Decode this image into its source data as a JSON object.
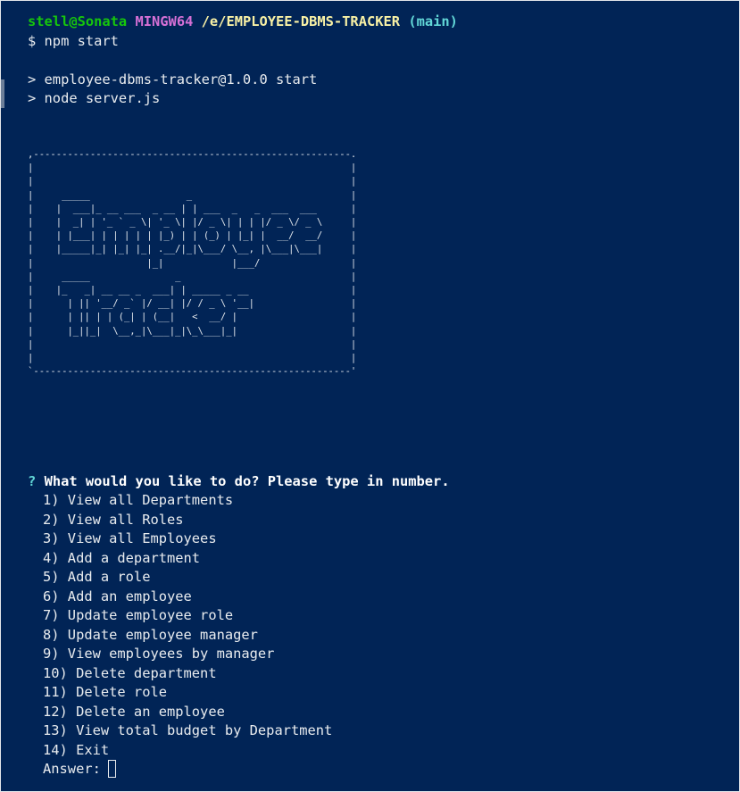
{
  "prompt": {
    "user_host": "stell@Sonata",
    "shell": "MINGW64",
    "path": "/e/EMPLOYEE-DBMS-TRACKER",
    "branch": "(main)",
    "command": "$ npm start"
  },
  "npm_output": {
    "line1": "> employee-dbms-tracker@1.0.0 start",
    "line2": "> node server.js"
  },
  "banner": {
    "ascii_art": ",--------------------------------------------------------.\n|                                                        |\n|                                                        |\n|     _____                 _                            |\n|    |  ___|_ __ ___  _ __ | | ___  _   _  ___  ___      |\n|    |  _| | '_ ` _ \\| '_ \\| |/ _ \\| | | |/ _ \\/ _ \\     |\n|    | |___| | | | | | |_) | | (_) | |_| |  __/  __/     |\n|    |_____|_| |_| |_| .__/|_|\\___/ \\__, |\\___|\\___|     |\n|                    |_|            |___/                |\n|     _____               _                              |\n|    |_   _| __ __ _  ___| | _____ _ __                  |\n|      | || '__/ _` |/ __| |/ / _ \\ '__|                 |\n|      | || | | (_| | (__|   <  __/ |                    |\n|      |_||_|  \\__,_|\\___|_|\\_\\___|_|                    |\n|                                                        |\n|                                                        |\n`--------------------------------------------------------'"
  },
  "menu": {
    "question_mark": "?",
    "question": "What would you like to do? Please type in number.",
    "selected_index": 0,
    "options": [
      "1) View all Departments",
      "2) View all Roles",
      "3) View all Employees",
      "4) Add a department",
      "5) Add a role",
      "6) Add an employee",
      "7) Update employee role",
      "8) Update employee manager",
      "9) View employees by manager",
      "10) Delete department",
      "11) Delete role",
      "12) Delete an employee",
      "13) View total budget by Department",
      "14) Exit"
    ],
    "answer_label": "Answer:",
    "answer_value": ""
  },
  "colors": {
    "background": "#012456",
    "user": "#16c60c",
    "shell": "#d670d6",
    "path": "#f9f1a5",
    "branch": "#61d6d6",
    "selected_option": "#61d6d6",
    "text": "#e9ecef"
  }
}
